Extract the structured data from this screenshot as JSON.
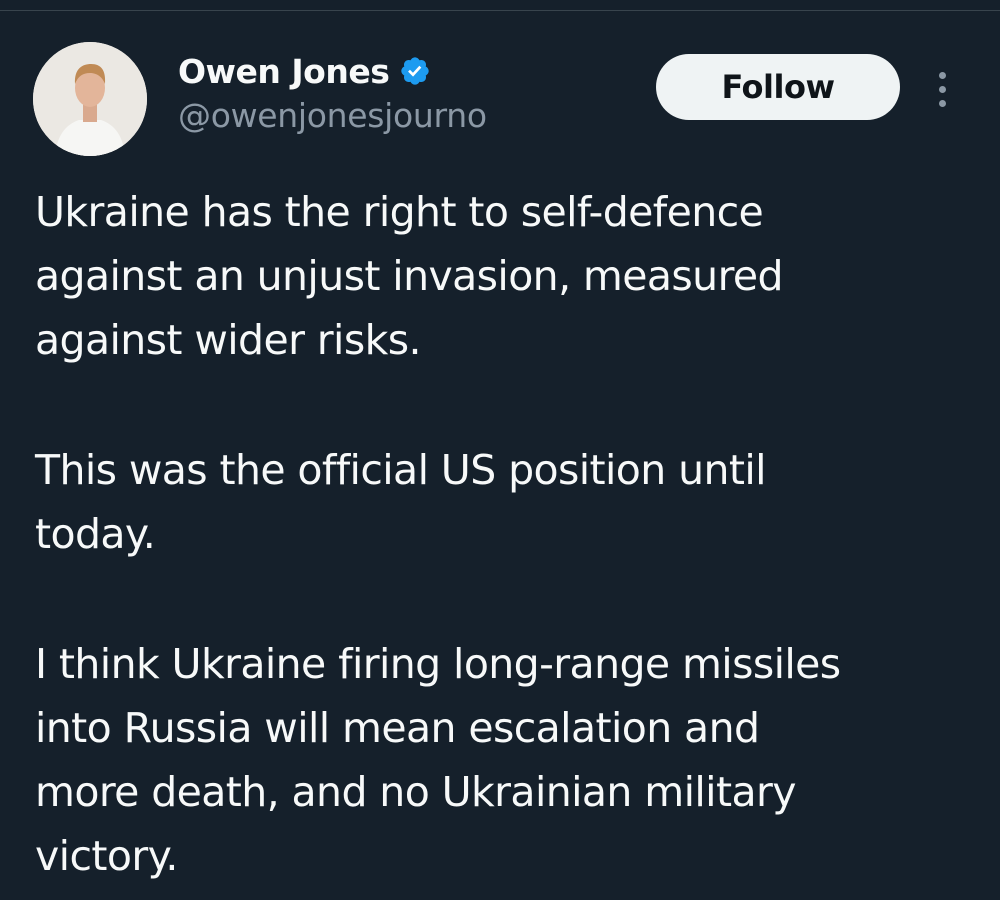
{
  "tweet": {
    "author": {
      "display_name": "Owen Jones",
      "handle": "@owenjonesjourno",
      "verified": true,
      "avatar_icon": "profile-photo"
    },
    "actions": {
      "follow_label": "Follow",
      "more_icon": "more-vertical-icon"
    },
    "paragraphs": [
      {
        "lines": [
          "Ukraine has the right to self-defence",
          "against an unjust invasion, measured",
          "against wider risks."
        ]
      },
      {
        "lines": [
          "This was the official US position until",
          "today."
        ]
      },
      {
        "lines": [
          "I think Ukraine firing long-range missiles",
          "into Russia will mean escalation and",
          "more death, and no Ukrainian military",
          "victory."
        ]
      }
    ]
  },
  "colors": {
    "background": "#15202b",
    "text": "#f7f9f9",
    "secondary_text": "#8b98a5",
    "verified_badge": "#1d9bf0",
    "follow_button_bg": "#eff3f4",
    "follow_button_text": "#0f1419"
  }
}
